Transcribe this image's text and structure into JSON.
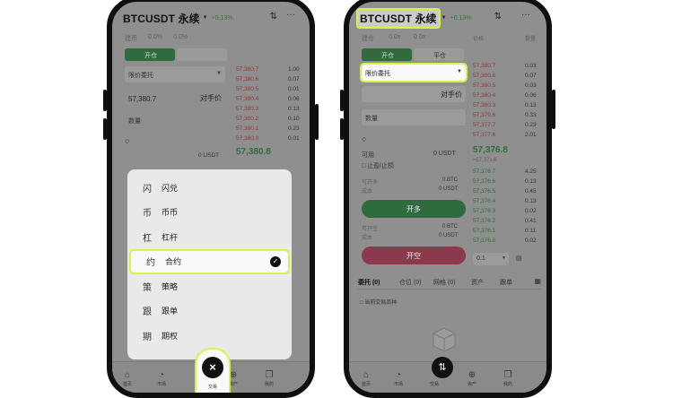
{
  "left_phone": {
    "header": {
      "pair": "BTCUSDT 永续",
      "change": "+0.13%"
    },
    "order_tabs": [
      "建币",
      "0.0%",
      "0.0%"
    ],
    "open_label": "开仓",
    "order_type": "限价委托",
    "price": "57,380.7",
    "price_btn": "对手价",
    "qty_label": "数量",
    "avail": "0 USDT",
    "last_price": "57,380.8",
    "asks": [
      "57,380.7",
      "57,380.6",
      "57,380.5",
      "57,380.4",
      "57,380.3",
      "57,380.2",
      "57,380.1",
      "57,380.0"
    ],
    "ask_sizes": [
      "1.00",
      "0.07",
      "0.01",
      "0.06",
      "0.13",
      "0.10",
      "0.23",
      "0.01"
    ],
    "sheet": {
      "items": [
        {
          "icon": "闪",
          "label": "闪兑"
        },
        {
          "icon": "币",
          "label": "币币"
        },
        {
          "icon": "杠",
          "label": "杠杆"
        },
        {
          "icon": "约",
          "label": "合约"
        },
        {
          "icon": "策",
          "label": "策略"
        },
        {
          "icon": "跟",
          "label": "跟单"
        },
        {
          "icon": "期",
          "label": "期权"
        }
      ],
      "selected_index": 3
    },
    "close_glyph": "×",
    "close_label": "交易",
    "tabs": [
      "首页",
      "市场",
      "交易",
      "资产",
      "我的"
    ]
  },
  "right_phone": {
    "header": {
      "pair": "BTCUSDT 永续",
      "change": "+0.13%"
    },
    "order_tabs": [
      "建仓",
      "0.0x",
      "0.0x"
    ],
    "seg_open": "开仓",
    "seg_close": "平仓",
    "order_type": "限价委托",
    "price_btn": "对手价",
    "qty_label": "数量",
    "avail_label": "可用",
    "avail": "0 USDT",
    "tpsl": "止盈/止损",
    "max_open_label": "可开多",
    "max_open": "0 BTC",
    "cost_label": "成本",
    "cost": "0 USDT",
    "open_long": "开多",
    "max_short_label": "可开空",
    "max_short": "0 BTC",
    "cost2_label": "成本",
    "cost2": "0 USDT",
    "open_short": "开空",
    "last_price": "57,376.8",
    "mark": "≈57,371.6",
    "ob_head": [
      "价格",
      "数量"
    ],
    "asks": [
      "57,380.7",
      "57,380.6",
      "57,380.5",
      "57,380.4",
      "57,380.3",
      "57,379.6",
      "57,377.7",
      "57,377.6"
    ],
    "ask_sizes": [
      "0.03",
      "0.07",
      "0.03",
      "0.06",
      "0.13",
      "0.33",
      "0.23",
      "2.01"
    ],
    "bids": [
      "57,376.7",
      "57,376.6",
      "57,376.5",
      "57,376.4",
      "57,376.3",
      "57,376.2",
      "57,376.1",
      "57,376.0"
    ],
    "bid_sizes": [
      "4.25",
      "0.13",
      "0.45",
      "0.13",
      "0.02",
      "0.41",
      "0.11",
      "0.02"
    ],
    "depth_sel": "0.1",
    "bottom_tabs": [
      "委托 (0)",
      "仓位 (0)",
      "网格 (0)",
      "资产",
      "跟单"
    ],
    "only_current": "当前交易品种",
    "tabs": [
      "首页",
      "市场",
      "交易",
      "资产",
      "我的"
    ]
  }
}
